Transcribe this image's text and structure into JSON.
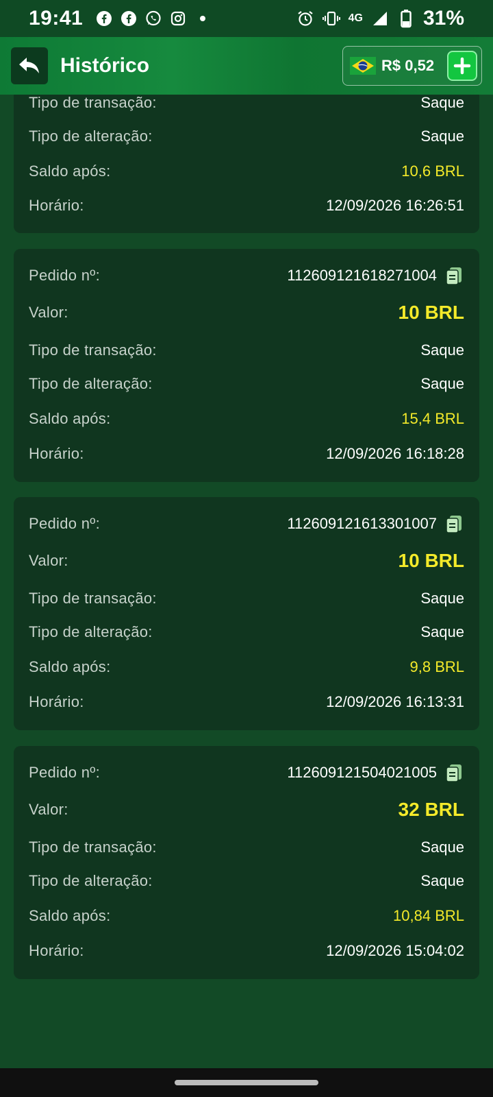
{
  "status_bar": {
    "time": "19:41",
    "icons_left": [
      "facebook-icon",
      "facebook-icon",
      "whatsapp-icon",
      "instagram-icon",
      "dot-icon"
    ],
    "network": "4G",
    "battery": "31%"
  },
  "header": {
    "title": "Histórico",
    "balance": "R$ 0,52"
  },
  "labels": {
    "order": "Pedido nº:",
    "amount": "Valor:",
    "transaction_type": "Tipo de transação:",
    "change_type": "Tipo de alteração:",
    "balance_after": "Saldo após:",
    "time": "Horário:"
  },
  "records": [
    {
      "transaction_type": "Saque",
      "change_type": "Saque",
      "balance_after": "10,6 BRL",
      "time": "12/09/2026 16:26:51"
    },
    {
      "order_no": "112609121618271004",
      "amount": "10 BRL",
      "transaction_type": "Saque",
      "change_type": "Saque",
      "balance_after": "15,4 BRL",
      "time": "12/09/2026 16:18:28"
    },
    {
      "order_no": "112609121613301007",
      "amount": "10 BRL",
      "transaction_type": "Saque",
      "change_type": "Saque",
      "balance_after": "9,8 BRL",
      "time": "12/09/2026 16:13:31"
    },
    {
      "order_no": "112609121504021005",
      "amount": "32 BRL",
      "transaction_type": "Saque",
      "change_type": "Saque",
      "balance_after": "10,84 BRL",
      "time": "12/09/2026 15:04:02"
    }
  ]
}
